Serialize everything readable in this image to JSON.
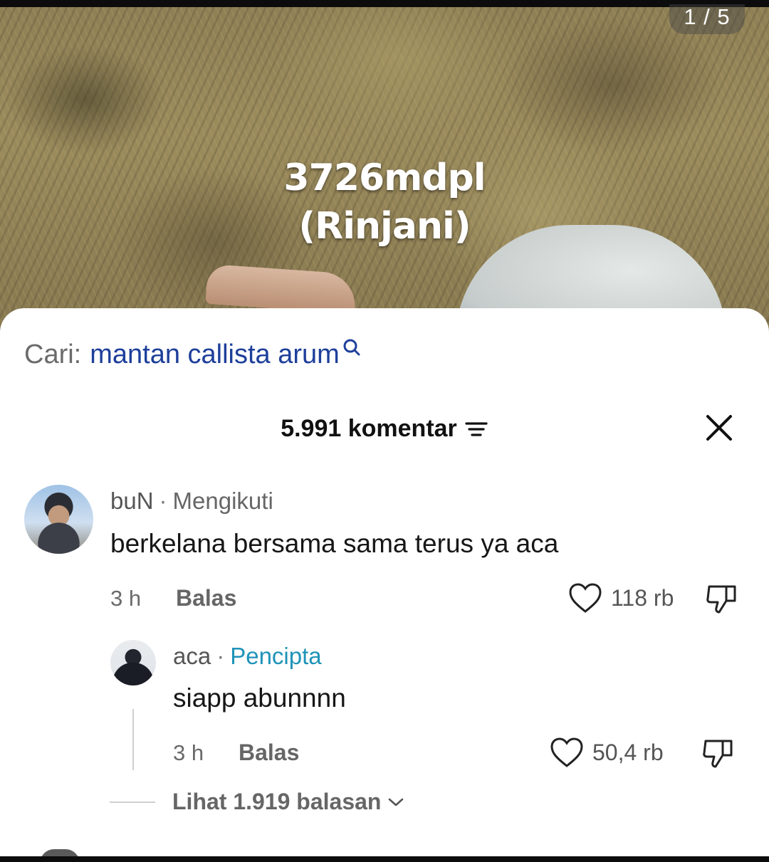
{
  "media": {
    "page_counter": "1 / 5",
    "overlay_line1": "3726mdpl",
    "overlay_line2": "(Rinjani)"
  },
  "search": {
    "prefix": "Cari:",
    "query": "mantan callista arum",
    "icon": "search-icon"
  },
  "header": {
    "comment_count": "5.991 komentar",
    "filter_icon": "filter-icon",
    "close_icon": "close-icon"
  },
  "comments": [
    {
      "username": "buN",
      "role": "Mengikuti",
      "text": "berkelana bersama sama terus ya aca",
      "time": "3 h",
      "reply_label": "Balas",
      "likes": "118 rb"
    },
    {
      "username": "aca",
      "role": "Pencipta",
      "text": "siapp abunnnn",
      "time": "3 h",
      "reply_label": "Balas",
      "likes": "50,4 rb"
    }
  ],
  "replies": {
    "label": "Lihat 1.919 balasan"
  },
  "colors": {
    "search_query": "#1e3f9a",
    "creator_badge": "#1f93b8",
    "sheet_background": "#ffffff"
  }
}
